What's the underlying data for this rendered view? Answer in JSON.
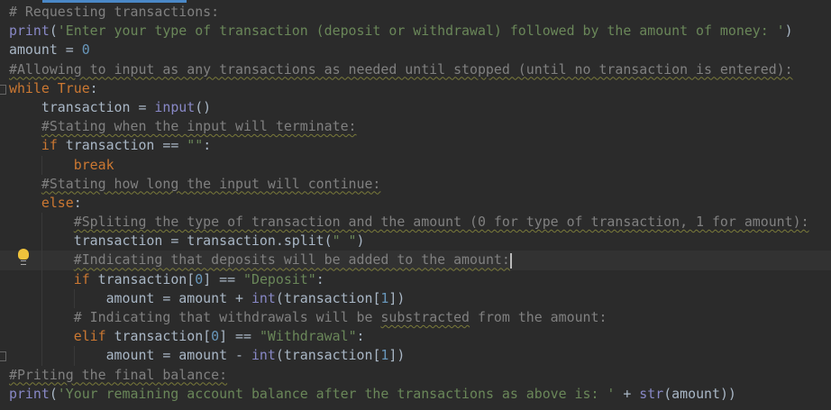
{
  "editor": {
    "current_line": 13,
    "colors": {
      "background": "#2b2b2b",
      "comment": "#808080",
      "keyword": "#cc7832",
      "string": "#6a8759",
      "number": "#6897bb",
      "builtin": "#8888c6"
    },
    "lines": [
      {
        "indent": 0,
        "tokens": [
          [
            "comment",
            "# Requesting transactions:"
          ]
        ]
      },
      {
        "indent": 0,
        "tokens": [
          [
            "builtin",
            "print"
          ],
          [
            "plain",
            "("
          ],
          [
            "str",
            "'Enter your type of transaction (deposit or withdrawal) followed by the amount of money: '"
          ],
          [
            "plain",
            ")"
          ]
        ]
      },
      {
        "indent": 0,
        "tokens": [
          [
            "plain",
            "amount = "
          ],
          [
            "num",
            "0"
          ]
        ]
      },
      {
        "indent": 0,
        "tokens": [
          [
            "comment-typo",
            "#Allowing to input as any transactions as needed until stopped (until no transaction is entered):"
          ]
        ]
      },
      {
        "indent": 0,
        "tokens": [
          [
            "kw",
            "while "
          ],
          [
            "kw",
            "True"
          ],
          [
            "plain",
            ":"
          ]
        ]
      },
      {
        "indent": 1,
        "tokens": [
          [
            "plain",
            "transaction = "
          ],
          [
            "builtin",
            "input"
          ],
          [
            "plain",
            "()"
          ]
        ]
      },
      {
        "indent": 1,
        "tokens": [
          [
            "comment-typo",
            "#Stating when the input will terminate:"
          ]
        ]
      },
      {
        "indent": 1,
        "tokens": [
          [
            "kw",
            "if "
          ],
          [
            "plain",
            "transaction == "
          ],
          [
            "str",
            "\"\""
          ],
          [
            "plain",
            ":"
          ]
        ]
      },
      {
        "indent": 2,
        "tokens": [
          [
            "kw",
            "break"
          ]
        ]
      },
      {
        "indent": 1,
        "tokens": [
          [
            "comment-typo",
            "#Stating how long the input will continue:"
          ]
        ]
      },
      {
        "indent": 1,
        "tokens": [
          [
            "kw",
            "else"
          ],
          [
            "plain",
            ":"
          ]
        ]
      },
      {
        "indent": 2,
        "tokens": [
          [
            "comment-typo",
            "#Spliting the type of transaction and the amount (0 for type of transaction, 1 for amount):"
          ]
        ]
      },
      {
        "indent": 2,
        "tokens": [
          [
            "plain",
            "transaction = transaction.split("
          ],
          [
            "str",
            "\" \""
          ],
          [
            "plain",
            ")"
          ]
        ]
      },
      {
        "indent": 2,
        "tokens": [
          [
            "comment-typo",
            "#Indicating that deposits will be added to the amount:"
          ]
        ]
      },
      {
        "indent": 2,
        "tokens": [
          [
            "kw",
            "if "
          ],
          [
            "plain",
            "transaction["
          ],
          [
            "num",
            "0"
          ],
          [
            "plain",
            "] == "
          ],
          [
            "str",
            "\"Deposit\""
          ],
          [
            "plain",
            ":"
          ]
        ]
      },
      {
        "indent": 3,
        "tokens": [
          [
            "plain",
            "amount = amount + "
          ],
          [
            "builtin",
            "int"
          ],
          [
            "plain",
            "(transaction["
          ],
          [
            "num",
            "1"
          ],
          [
            "plain",
            "])"
          ]
        ]
      },
      {
        "indent": 2,
        "tokens": [
          [
            "comment",
            "# Indicating that withdrawals will be "
          ],
          [
            "comment-typo",
            "substracted"
          ],
          [
            "comment",
            " from the amount:"
          ]
        ]
      },
      {
        "indent": 2,
        "tokens": [
          [
            "kw",
            "elif "
          ],
          [
            "plain",
            "transaction["
          ],
          [
            "num",
            "0"
          ],
          [
            "plain",
            "] == "
          ],
          [
            "str",
            "\"Withdrawal\""
          ],
          [
            "plain",
            ":"
          ]
        ]
      },
      {
        "indent": 3,
        "tokens": [
          [
            "plain",
            "amount = amount - "
          ],
          [
            "builtin",
            "int"
          ],
          [
            "plain",
            "(transaction["
          ],
          [
            "num",
            "1"
          ],
          [
            "plain",
            "])"
          ]
        ]
      },
      {
        "indent": 0,
        "tokens": [
          [
            "comment-typo",
            "#Priting the final balance:"
          ]
        ]
      },
      {
        "indent": 0,
        "tokens": [
          [
            "builtin",
            "print"
          ],
          [
            "plain",
            "("
          ],
          [
            "str",
            "'Your remaining account balance after the transactions as above is: '"
          ],
          [
            "plain",
            " + "
          ],
          [
            "builtin",
            "str"
          ],
          [
            "plain",
            "(amount))"
          ]
        ]
      }
    ]
  }
}
